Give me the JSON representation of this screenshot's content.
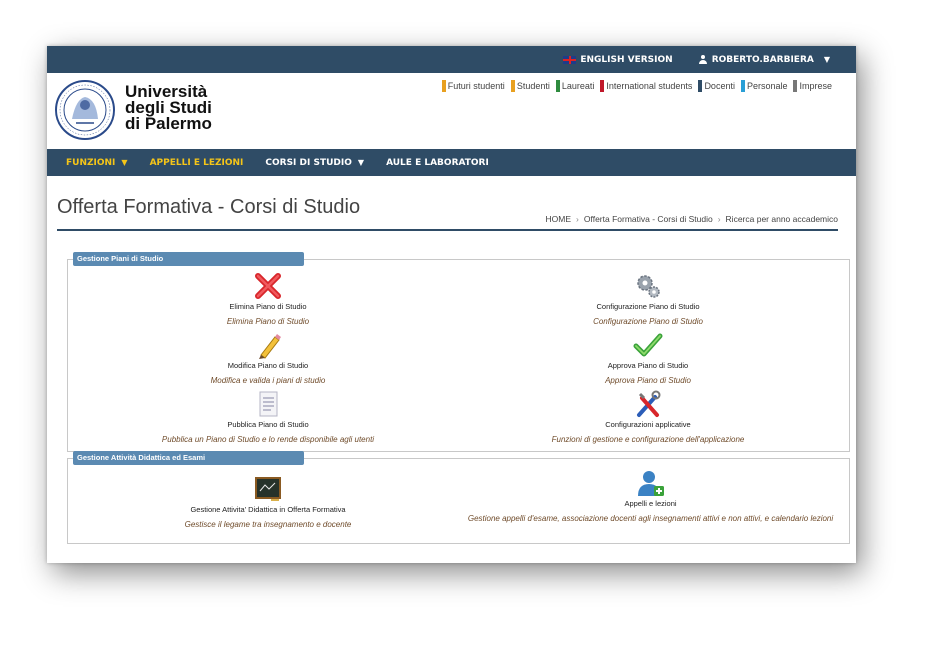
{
  "topbar": {
    "english_label": "ENGLISH VERSION",
    "user_label": "ROBERTO.BARBIERA"
  },
  "header": {
    "logo_line1": "Università",
    "logo_line2": "degli Studi",
    "logo_line3": "di Palermo",
    "audience_links": [
      {
        "label": "Futuri studenti",
        "color": "#e8a020"
      },
      {
        "label": "Studenti",
        "color": "#e8a020"
      },
      {
        "label": "Laureati",
        "color": "#2e8b3e"
      },
      {
        "label": "International students",
        "color": "#c0182a"
      },
      {
        "label": "Docenti",
        "color": "#2f4c66"
      },
      {
        "label": "Personale",
        "color": "#2a9fd6"
      },
      {
        "label": "Imprese",
        "color": "#777777"
      }
    ]
  },
  "nav": {
    "funzioni": "FUNZIONI",
    "appelli": "APPELLI E LEZIONI",
    "corsi": "CORSI DI STUDIO",
    "aule": "AULE E LABORATORI"
  },
  "page": {
    "title": "Offerta Formativa - Corsi di Studio",
    "breadcrumb": [
      "HOME",
      "Offerta Formativa - Corsi di Studio",
      "Ricerca per anno accademico"
    ]
  },
  "panels": {
    "piani": {
      "label": "Gestione Piani di Studio",
      "tiles": [
        {
          "title": "Elimina Piano di Studio",
          "desc": "Elimina Piano di Studio",
          "icon": "delete-x-icon"
        },
        {
          "title": "Configurazione Piano di Studio",
          "desc": "Configurazione Piano di Studio",
          "icon": "gears-icon"
        },
        {
          "title": "Modifica Piano di Studio",
          "desc": "Modifica e valida i piani di studio",
          "icon": "pencil-icon"
        },
        {
          "title": "Approva Piano di Studio",
          "desc": "Approva Piano di Studio",
          "icon": "checkmark-icon"
        },
        {
          "title": "Pubblica Piano di Studio",
          "desc": "Pubblica un Piano di Studio e lo rende disponibile agli utenti",
          "icon": "document-icon"
        },
        {
          "title": "Configurazioni applicative",
          "desc": "Funzioni di gestione e configurazione dell'applicazione",
          "icon": "tools-icon"
        }
      ]
    },
    "attivita": {
      "label": "Gestione Attività Didattica ed Esami",
      "tiles": [
        {
          "title": "Gestione Attivita' Didattica in Offerta Formativa",
          "desc": "Gestisce il legame tra insegnamento e docente",
          "icon": "blackboard-icon"
        },
        {
          "title": "Appelli e lezioni",
          "desc": "Gestione appelli d'esame, associazione docenti agli insegnamenti attivi e non attivi, e calendario lezioni",
          "icon": "user-add-icon"
        }
      ]
    }
  }
}
